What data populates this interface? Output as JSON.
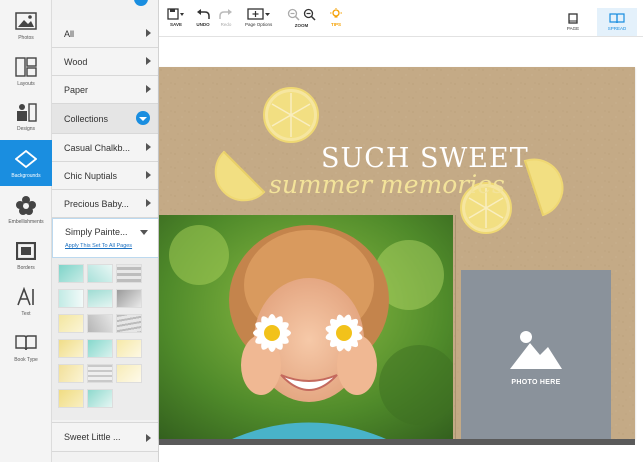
{
  "sidebar": {
    "items": [
      {
        "label": "Photos",
        "icon": "photos-icon"
      },
      {
        "label": "Layouts",
        "icon": "layouts-icon"
      },
      {
        "label": "Designs",
        "icon": "designs-icon"
      },
      {
        "label": "Backgrounds",
        "icon": "backgrounds-icon",
        "active": true
      },
      {
        "label": "Embellishments",
        "icon": "embellishments-icon"
      },
      {
        "label": "Borders",
        "icon": "borders-icon"
      },
      {
        "label": "Text",
        "icon": "text-icon"
      },
      {
        "label": "Book Type",
        "icon": "book-type-icon"
      }
    ]
  },
  "categories": {
    "items": [
      "All",
      "Wood",
      "Paper"
    ],
    "collections_label": "Collections",
    "collections": [
      "Casual Chalkb...",
      "Chic Nuptials",
      "Precious Baby..."
    ],
    "expanded": {
      "label": "Simply Painte...",
      "apply_link": "Apply This Set To All Pages"
    },
    "after": [
      "Sweet Little ..."
    ]
  },
  "toolbar": {
    "save": "SAVE",
    "undo": "UNDO",
    "redo": "Redo",
    "page_options": "Page Options",
    "zoom": "ZOOM",
    "tips": "TIPS",
    "page": "PAGE",
    "spread": "SPREAD"
  },
  "canvas": {
    "title_line1": "SUCH SWEET",
    "title_line2": "summer memories",
    "photo_placeholder": "PHOTO HERE"
  },
  "colors": {
    "accent": "#1a8ee0",
    "kraft": "#c4aa86",
    "lemon": "#f2df82",
    "placeholder": "#8a929b"
  }
}
